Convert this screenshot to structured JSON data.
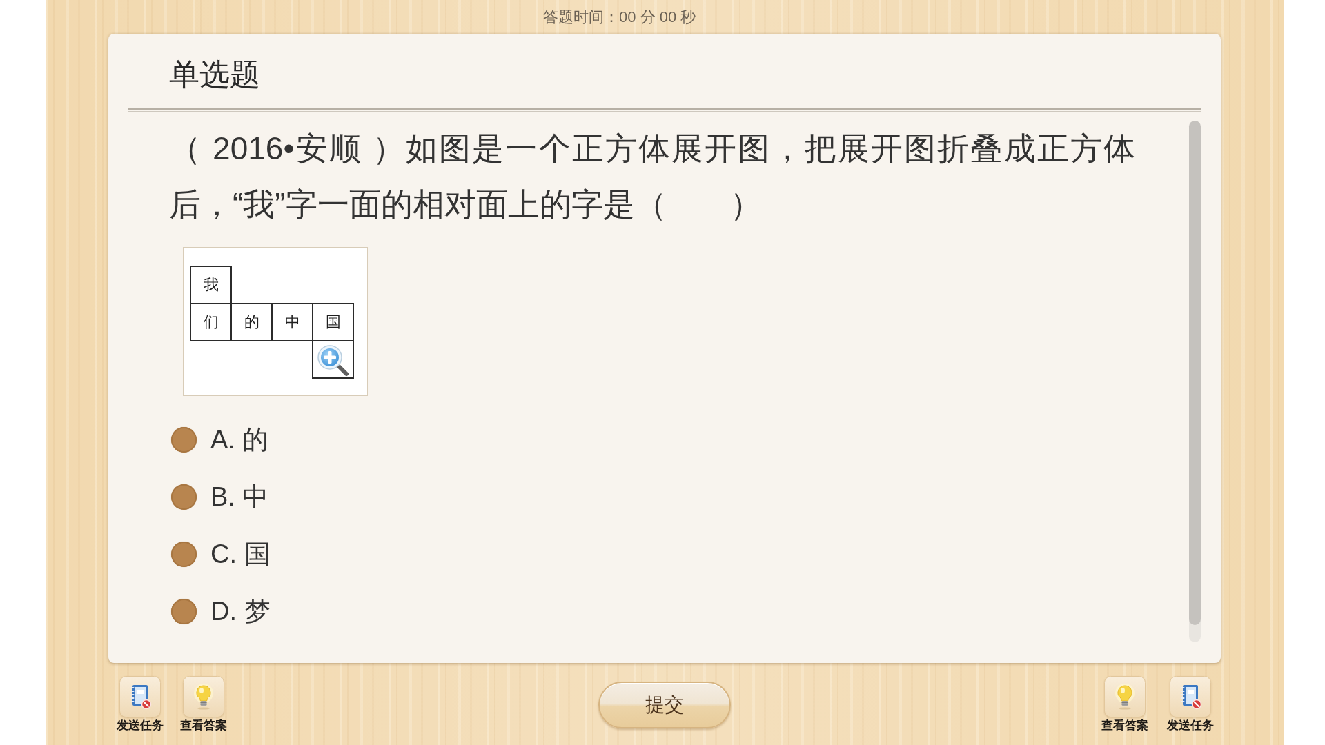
{
  "timer": "答题时间：00 分 00 秒",
  "card": {
    "title": "单选题",
    "question": "（ 2016•安顺 ）如图是一个正方体展开图，把展开图折叠成正方体后，“我”字一面的相对面上的字是（　　）",
    "figure": {
      "rows": [
        [
          {
            "kind": "face",
            "text": "我"
          }
        ],
        [
          {
            "kind": "face",
            "text": "们"
          },
          {
            "kind": "face",
            "text": "的"
          },
          {
            "kind": "face",
            "text": "中"
          },
          {
            "kind": "face",
            "text": "国"
          }
        ],
        [
          {
            "kind": "gap"
          },
          {
            "kind": "gap"
          },
          {
            "kind": "gap"
          },
          {
            "kind": "face"
          }
        ]
      ]
    },
    "options": [
      {
        "label": "A. 的",
        "selected": false
      },
      {
        "label": "B. 中",
        "selected": false
      },
      {
        "label": "C. 国",
        "selected": false
      },
      {
        "label": "D. 梦",
        "selected": false
      }
    ]
  },
  "toolbar_left": [
    {
      "kind": "send_task",
      "label": "发送任务"
    },
    {
      "kind": "view_answer",
      "label": "查看答案"
    }
  ],
  "submit_button": "提交",
  "toolbar_right": [
    {
      "kind": "view_answer",
      "label": "查看答案"
    },
    {
      "kind": "send_task",
      "label": "发送任务"
    }
  ]
}
